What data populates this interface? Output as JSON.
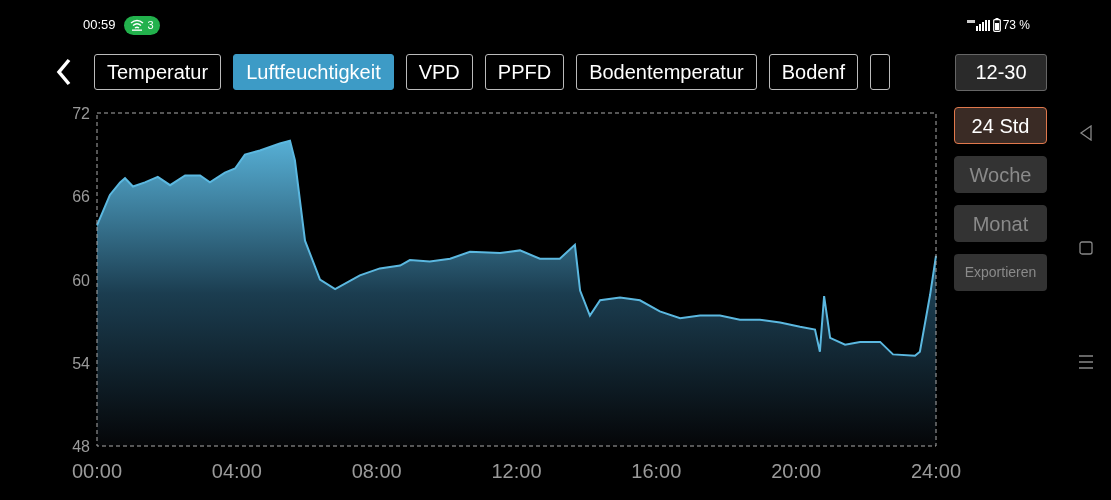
{
  "status_bar": {
    "time": "00:59",
    "hotspot_count": "3",
    "battery": "73 %"
  },
  "tabs": [
    {
      "label": "Temperatur",
      "selected": false
    },
    {
      "label": "Luftfeuchtigkeit",
      "selected": true
    },
    {
      "label": "VPD",
      "selected": false
    },
    {
      "label": "PPFD",
      "selected": false
    },
    {
      "label": "Bodentemperatur",
      "selected": false
    },
    {
      "label": "Bodenf",
      "selected": false
    }
  ],
  "date_button": "12-30",
  "ranges": [
    {
      "label": "24 Std",
      "selected": true
    },
    {
      "label": "Woche",
      "selected": false
    },
    {
      "label": "Monat",
      "selected": false
    }
  ],
  "export_button": "Exportieren",
  "chart_data": {
    "type": "area",
    "x": [
      0,
      0.37,
      0.66,
      0.8,
      1.03,
      1.37,
      1.74,
      2.09,
      2.52,
      2.95,
      3.23,
      3.66,
      3.95,
      4.23,
      4.66,
      5.23,
      5.52,
      5.66,
      5.95,
      6.38,
      6.81,
      7.52,
      8.09,
      8.67,
      8.95,
      9.52,
      10.1,
      10.67,
      11.53,
      12.1,
      12.67,
      13.24,
      13.67,
      13.82,
      14.1,
      14.39,
      14.96,
      15.53,
      16.1,
      16.68,
      17.25,
      17.82,
      18.39,
      18.96,
      19.54,
      20.11,
      20.54,
      20.68,
      20.8,
      20.97,
      21.4,
      21.83,
      22.4,
      22.77,
      23.4,
      23.54,
      23.83,
      24
    ],
    "series": [
      {
        "color": "#5bb8e0",
        "values": [
          63.9,
          66.1,
          67.0,
          67.3,
          66.7,
          67.0,
          67.4,
          66.8,
          67.5,
          67.5,
          67.0,
          67.7,
          68.0,
          69.0,
          69.3,
          69.8,
          70.0,
          68.6,
          62.8,
          60.0,
          59.3,
          60.3,
          60.8,
          61.0,
          61.4,
          61.3,
          61.5,
          62.0,
          61.9,
          62.1,
          61.5,
          61.5,
          62.5,
          59.2,
          57.4,
          58.5,
          58.7,
          58.5,
          57.7,
          57.2,
          57.4,
          57.4,
          57.1,
          57.1,
          56.9,
          56.6,
          56.4,
          54.8,
          58.8,
          55.8,
          55.3,
          55.5,
          55.5,
          54.6,
          54.5,
          54.8,
          58.9,
          61.7
        ]
      }
    ],
    "xlim": [
      0,
      24
    ],
    "ylim": [
      48,
      72
    ],
    "xticks": [
      {
        "value": 0,
        "label": "00:00"
      },
      {
        "value": 4,
        "label": "04:00"
      },
      {
        "value": 8,
        "label": "08:00"
      },
      {
        "value": 12,
        "label": "12:00"
      },
      {
        "value": 16,
        "label": "16:00"
      },
      {
        "value": 20,
        "label": "20:00"
      },
      {
        "value": 24,
        "label": "24:00"
      }
    ],
    "yticks": [
      48,
      54,
      60,
      66,
      72
    ]
  }
}
